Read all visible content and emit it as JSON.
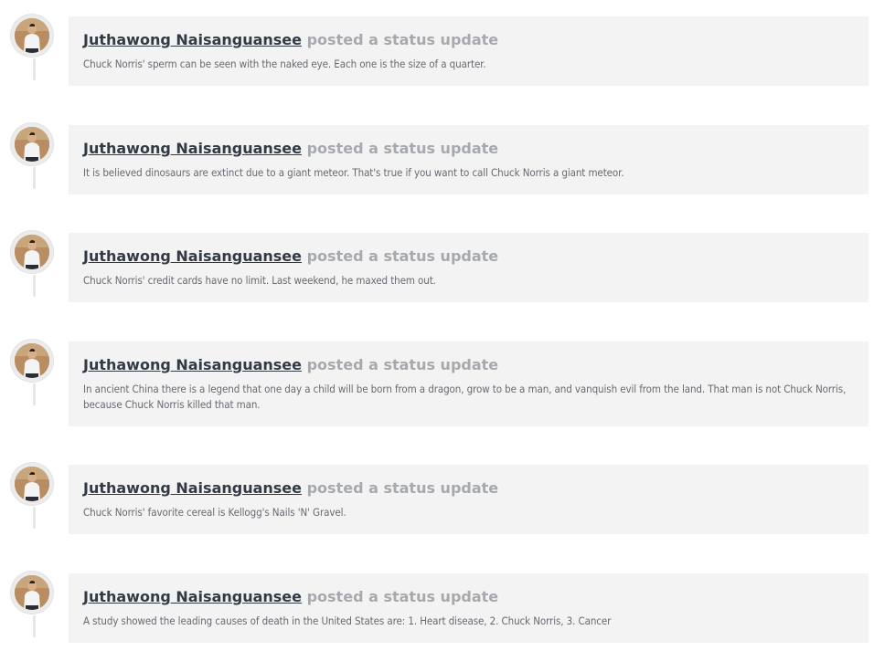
{
  "feed": {
    "posts": [
      {
        "author": "Juthawong Naisanguansee",
        "action": "posted a status update",
        "text": "Chuck Norris' sperm can be seen with the naked eye. Each one is the size of a quarter."
      },
      {
        "author": "Juthawong Naisanguansee",
        "action": "posted a status update",
        "text": "It is believed dinosaurs are extinct due to a giant meteor. That's true if you want to call Chuck Norris a giant meteor."
      },
      {
        "author": "Juthawong Naisanguansee",
        "action": "posted a status update",
        "text": "Chuck Norris' credit cards have no limit. Last weekend, he maxed them out."
      },
      {
        "author": "Juthawong Naisanguansee",
        "action": "posted a status update",
        "text": "In ancient China there is a legend that one day a child will be born from a dragon, grow to be a man, and vanquish evil from the land. That man is not Chuck Norris, because Chuck Norris killed that man."
      },
      {
        "author": "Juthawong Naisanguansee",
        "action": "posted a status update",
        "text": "Chuck Norris' favorite cereal is Kellogg's Nails 'N' Gravel."
      },
      {
        "author": "Juthawong Naisanguansee",
        "action": "posted a status update",
        "text": "A study showed the leading causes of death in the United States are: 1. Heart disease, 2. Chuck Norris, 3. Cancer"
      }
    ]
  }
}
